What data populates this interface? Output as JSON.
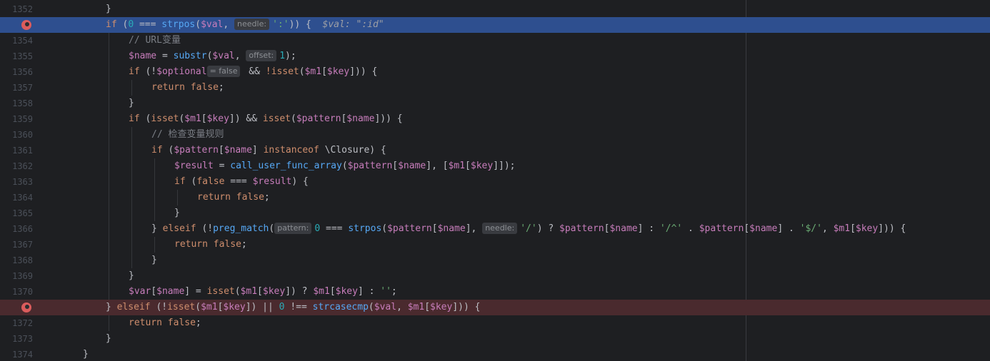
{
  "editor": {
    "lines": [
      {
        "num": "1352",
        "type": "normal",
        "indent": 3,
        "tokens": [
          [
            "p",
            "}"
          ]
        ]
      },
      {
        "num": "",
        "type": "exec",
        "breakpoint": true,
        "indent": 3,
        "tokens": [
          [
            "k",
            "if"
          ],
          [
            "p",
            " ("
          ],
          [
            "n",
            "0"
          ],
          [
            "p",
            " === "
          ],
          [
            "f",
            "strpos"
          ],
          [
            "p",
            "("
          ],
          [
            "v",
            "$val"
          ],
          [
            "p",
            ", "
          ],
          [
            "h",
            "needle:"
          ],
          [
            "s",
            "':'"
          ],
          [
            "p",
            ")) {  "
          ],
          [
            "iv",
            "$val: \":id\""
          ]
        ]
      },
      {
        "num": "1354",
        "type": "normal",
        "indent": 4,
        "tokens": [
          [
            "c",
            "// URL变量"
          ]
        ]
      },
      {
        "num": "1355",
        "type": "normal",
        "indent": 4,
        "tokens": [
          [
            "v",
            "$name"
          ],
          [
            "p",
            " = "
          ],
          [
            "f",
            "substr"
          ],
          [
            "p",
            "("
          ],
          [
            "v",
            "$val"
          ],
          [
            "p",
            ", "
          ],
          [
            "h",
            "offset:"
          ],
          [
            "n",
            "1"
          ],
          [
            "p",
            ");"
          ]
        ]
      },
      {
        "num": "1356",
        "type": "normal",
        "indent": 4,
        "tokens": [
          [
            "k",
            "if"
          ],
          [
            "p",
            " (!"
          ],
          [
            "v",
            "$optional"
          ],
          [
            "h",
            "= false"
          ],
          [
            "p",
            " && "
          ],
          [
            "k",
            "!isset"
          ],
          [
            "p",
            "("
          ],
          [
            "v",
            "$m1"
          ],
          [
            "p",
            "["
          ],
          [
            "v",
            "$key"
          ],
          [
            "p",
            "])) {"
          ]
        ]
      },
      {
        "num": "1357",
        "type": "normal",
        "indent": 5,
        "tokens": [
          [
            "k",
            "return false"
          ],
          [
            "p",
            ";"
          ]
        ]
      },
      {
        "num": "1358",
        "type": "normal",
        "indent": 4,
        "tokens": [
          [
            "p",
            "}"
          ]
        ]
      },
      {
        "num": "1359",
        "type": "normal",
        "indent": 4,
        "tokens": [
          [
            "k",
            "if"
          ],
          [
            "p",
            " ("
          ],
          [
            "k",
            "isset"
          ],
          [
            "p",
            "("
          ],
          [
            "v",
            "$m1"
          ],
          [
            "p",
            "["
          ],
          [
            "v",
            "$key"
          ],
          [
            "p",
            "]) && "
          ],
          [
            "k",
            "isset"
          ],
          [
            "p",
            "("
          ],
          [
            "v",
            "$pattern"
          ],
          [
            "p",
            "["
          ],
          [
            "v",
            "$name"
          ],
          [
            "p",
            "])) {"
          ]
        ]
      },
      {
        "num": "1360",
        "type": "normal",
        "indent": 5,
        "tokens": [
          [
            "c",
            "// 检查变量规则"
          ]
        ]
      },
      {
        "num": "1361",
        "type": "normal",
        "indent": 5,
        "tokens": [
          [
            "k",
            "if"
          ],
          [
            "p",
            " ("
          ],
          [
            "v",
            "$pattern"
          ],
          [
            "p",
            "["
          ],
          [
            "v",
            "$name"
          ],
          [
            "p",
            "] "
          ],
          [
            "k",
            "instanceof"
          ],
          [
            "p",
            " \\Closure) {"
          ]
        ]
      },
      {
        "num": "1362",
        "type": "normal",
        "indent": 6,
        "tokens": [
          [
            "v",
            "$result"
          ],
          [
            "p",
            " = "
          ],
          [
            "f",
            "call_user_func_array"
          ],
          [
            "p",
            "("
          ],
          [
            "v",
            "$pattern"
          ],
          [
            "p",
            "["
          ],
          [
            "v",
            "$name"
          ],
          [
            "p",
            "], ["
          ],
          [
            "v",
            "$m1"
          ],
          [
            "p",
            "["
          ],
          [
            "v",
            "$key"
          ],
          [
            "p",
            "]]);"
          ]
        ]
      },
      {
        "num": "1363",
        "type": "normal",
        "indent": 6,
        "tokens": [
          [
            "k",
            "if"
          ],
          [
            "p",
            " ("
          ],
          [
            "k",
            "false"
          ],
          [
            "p",
            " === "
          ],
          [
            "v",
            "$result"
          ],
          [
            "p",
            ") {"
          ]
        ]
      },
      {
        "num": "1364",
        "type": "normal",
        "indent": 7,
        "tokens": [
          [
            "k",
            "return false"
          ],
          [
            "p",
            ";"
          ]
        ]
      },
      {
        "num": "1365",
        "type": "normal",
        "indent": 6,
        "tokens": [
          [
            "p",
            "}"
          ]
        ]
      },
      {
        "num": "1366",
        "type": "normal",
        "indent": 5,
        "tokens": [
          [
            "p",
            "} "
          ],
          [
            "k",
            "elseif"
          ],
          [
            "p",
            " (!"
          ],
          [
            "f",
            "preg_match"
          ],
          [
            "p",
            "("
          ],
          [
            "h",
            "pattern:"
          ],
          [
            "n",
            "0"
          ],
          [
            "p",
            " === "
          ],
          [
            "f",
            "strpos"
          ],
          [
            "p",
            "("
          ],
          [
            "v",
            "$pattern"
          ],
          [
            "p",
            "["
          ],
          [
            "v",
            "$name"
          ],
          [
            "p",
            "], "
          ],
          [
            "h",
            "needle:"
          ],
          [
            "s",
            "'/'"
          ],
          [
            "p",
            ") ? "
          ],
          [
            "v",
            "$pattern"
          ],
          [
            "p",
            "["
          ],
          [
            "v",
            "$name"
          ],
          [
            "p",
            "] : "
          ],
          [
            "s",
            "'/^'"
          ],
          [
            "p",
            " . "
          ],
          [
            "v",
            "$pattern"
          ],
          [
            "p",
            "["
          ],
          [
            "v",
            "$name"
          ],
          [
            "p",
            "] . "
          ],
          [
            "s",
            "'$/'"
          ],
          [
            "p",
            ", "
          ],
          [
            "v",
            "$m1"
          ],
          [
            "p",
            "["
          ],
          [
            "v",
            "$key"
          ],
          [
            "p",
            "])) {"
          ]
        ]
      },
      {
        "num": "1367",
        "type": "normal",
        "indent": 6,
        "tokens": [
          [
            "k",
            "return false"
          ],
          [
            "p",
            ";"
          ]
        ]
      },
      {
        "num": "1368",
        "type": "normal",
        "indent": 5,
        "tokens": [
          [
            "p",
            "}"
          ]
        ]
      },
      {
        "num": "1369",
        "type": "normal",
        "indent": 4,
        "tokens": [
          [
            "p",
            "}"
          ]
        ]
      },
      {
        "num": "1370",
        "type": "normal",
        "indent": 4,
        "tokens": [
          [
            "v",
            "$var"
          ],
          [
            "p",
            "["
          ],
          [
            "v",
            "$name"
          ],
          [
            "p",
            "] = "
          ],
          [
            "k",
            "isset"
          ],
          [
            "p",
            "("
          ],
          [
            "v",
            "$m1"
          ],
          [
            "p",
            "["
          ],
          [
            "v",
            "$key"
          ],
          [
            "p",
            "]) ? "
          ],
          [
            "v",
            "$m1"
          ],
          [
            "p",
            "["
          ],
          [
            "v",
            "$key"
          ],
          [
            "p",
            "] : "
          ],
          [
            "s",
            "''"
          ],
          [
            "p",
            ";"
          ]
        ]
      },
      {
        "num": "",
        "type": "bp",
        "breakpoint": true,
        "indent": 3,
        "tokens": [
          [
            "p",
            "} "
          ],
          [
            "k",
            "elseif"
          ],
          [
            "p",
            " (!"
          ],
          [
            "k",
            "isset"
          ],
          [
            "p",
            "("
          ],
          [
            "v",
            "$m1"
          ],
          [
            "p",
            "["
          ],
          [
            "v",
            "$key"
          ],
          [
            "p",
            "]) || "
          ],
          [
            "n",
            "0"
          ],
          [
            "p",
            " !== "
          ],
          [
            "f",
            "strcasecmp"
          ],
          [
            "p",
            "("
          ],
          [
            "v",
            "$val"
          ],
          [
            "p",
            ", "
          ],
          [
            "v",
            "$m1"
          ],
          [
            "p",
            "["
          ],
          [
            "v",
            "$key"
          ],
          [
            "p",
            "])) {"
          ]
        ]
      },
      {
        "num": "1372",
        "type": "normal",
        "indent": 4,
        "tokens": [
          [
            "k",
            "return false"
          ],
          [
            "p",
            ";"
          ]
        ]
      },
      {
        "num": "1373",
        "type": "normal",
        "indent": 3,
        "tokens": [
          [
            "p",
            "}"
          ]
        ]
      },
      {
        "num": "1374",
        "type": "normal",
        "indent": 2,
        "tokens": [
          [
            "p",
            "}"
          ]
        ]
      }
    ]
  }
}
